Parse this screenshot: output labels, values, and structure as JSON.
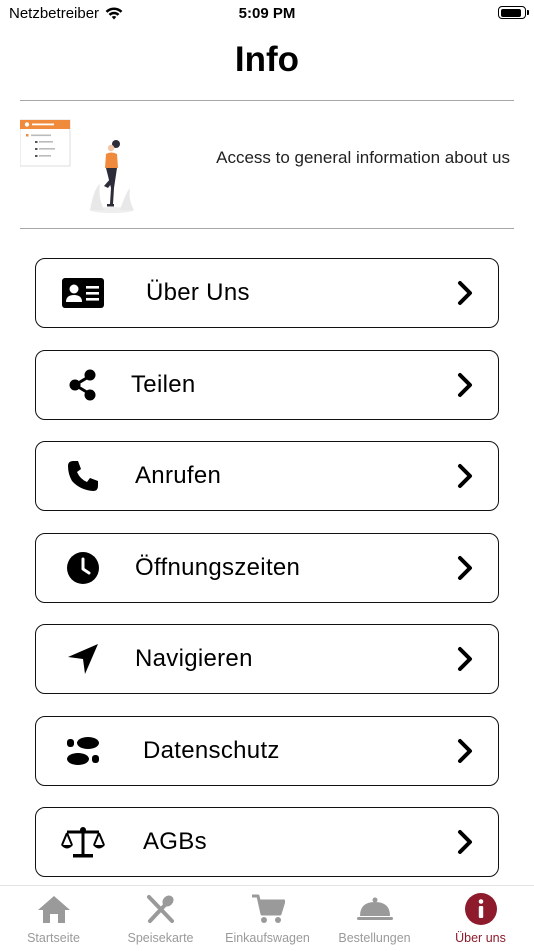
{
  "status_bar": {
    "carrier": "Netzbetreiber",
    "time": "5:09 PM",
    "battery_level": 0.9
  },
  "header": {
    "title": "Info"
  },
  "banner": {
    "text": "Access to general information about us"
  },
  "menu": {
    "items": [
      {
        "label": "Über Uns",
        "icon": "id-card-icon"
      },
      {
        "label": "Teilen",
        "icon": "share-icon"
      },
      {
        "label": "Anrufen",
        "icon": "phone-icon"
      },
      {
        "label": "Öffnungszeiten",
        "icon": "clock-icon"
      },
      {
        "label": "Navigieren",
        "icon": "navigation-arrow-icon"
      },
      {
        "label": "Datenschutz",
        "icon": "footprints-icon"
      },
      {
        "label": "AGBs",
        "icon": "balance-scale-icon"
      }
    ]
  },
  "tabbar": {
    "tabs": [
      {
        "label": "Startseite",
        "icon": "home-icon"
      },
      {
        "label": "Speisekarte",
        "icon": "utensils-icon"
      },
      {
        "label": "Einkaufswagen",
        "icon": "shopping-cart-icon"
      },
      {
        "label": "Bestellungen",
        "icon": "cloche-icon"
      },
      {
        "label": "Über uns",
        "icon": "info-icon",
        "active": true
      }
    ]
  },
  "colors": {
    "accent": "#8d1b2c",
    "tab_inactive": "#9a9a9a",
    "illustration_orange": "#f08a3c"
  }
}
